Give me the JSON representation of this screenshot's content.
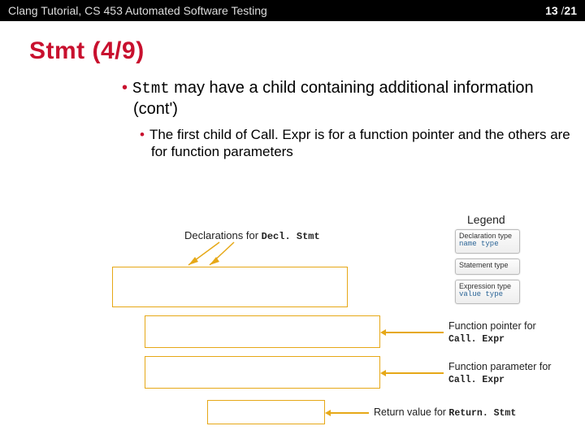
{
  "header": {
    "left": "Clang Tutorial, CS 453 Automated Software Testing",
    "page_current": "13",
    "page_sep": " /",
    "page_total": "21"
  },
  "title": "Stmt (4/9)",
  "bullet1_a": "Stmt",
  "bullet1_b": " may have a child containing additional information (cont')",
  "bullet2": "The first child of Call. Expr is for a function pointer and the others are for function parameters",
  "decl_caption_a": "Declarations for ",
  "decl_caption_b": "Decl. Stmt",
  "legend": {
    "title": "Legend",
    "box1_l1": "Declaration type",
    "box1_l2": "name type",
    "box2_l1": "Statement type",
    "box3_l1": "Expression type",
    "box3_l2": "value type"
  },
  "fp_a": "Function pointer for",
  "fp_b": "Call. Expr",
  "param_a": "Function parameter for",
  "param_b": "Call. Expr",
  "ret_a": "Return value for ",
  "ret_b": "Return. Stmt"
}
